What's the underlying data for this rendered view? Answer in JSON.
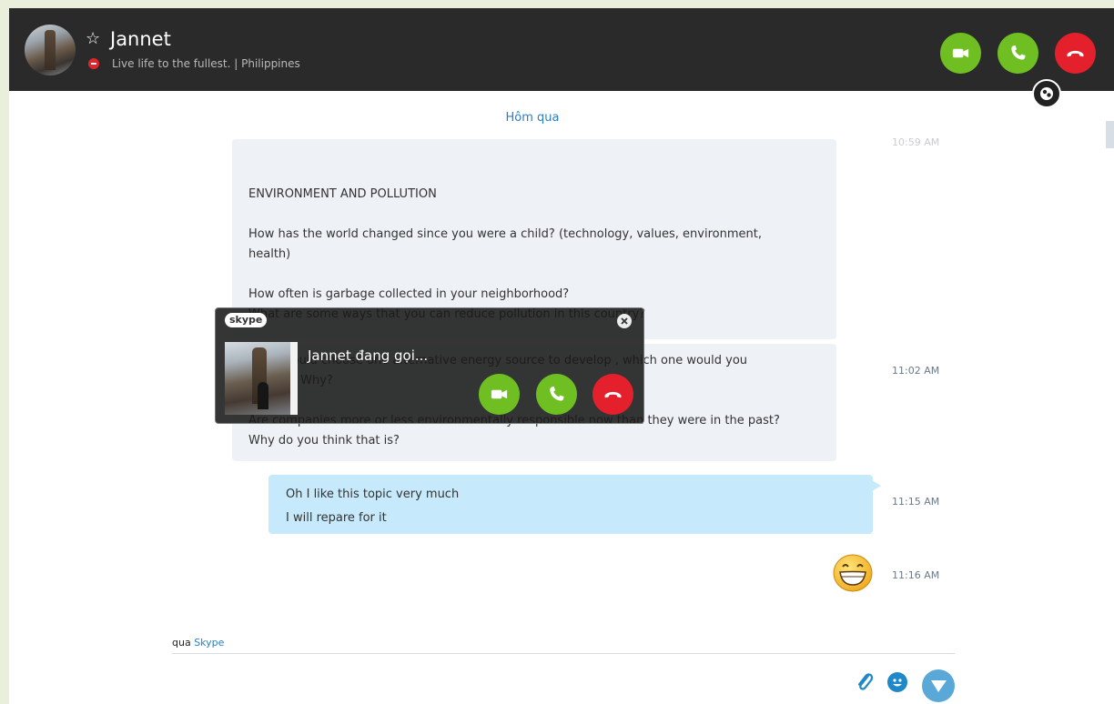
{
  "contact": {
    "name": "Jannet",
    "mood": "Live life to the fullest. | Philippines"
  },
  "icons": {
    "avatar": "contact-avatar",
    "favorite": "star-outline-icon",
    "status": "do-not-disturb-icon",
    "video": "video-camera-icon",
    "call": "phone-icon",
    "end": "hang-up-icon",
    "share": "share-screen-icon",
    "attach": "paperclip-icon",
    "emoji": "smiley-icon",
    "send": "send-icon"
  },
  "colors": {
    "green": "#6fbf23",
    "red": "#e3202b",
    "header": "#2a2a2a",
    "incoming": "#eef1f6",
    "outgoing": "#c6e9fb",
    "link": "#2a7fc4"
  },
  "chat": {
    "date_separator": "Hôm qua",
    "faded_time": "10:59 AM",
    "message1": {
      "lines": [
        "ENVIRONMENT AND POLLUTION",
        "",
        "How has the world changed since you were a child? (technology, values, environment,",
        "health)",
        "",
        "How often is garbage collected in your neighborhood?",
        "What are some ways that you can reduce pollution in this country?"
      ]
    },
    "message2": {
      "lines": [
        "If you could choose one alternative energy source to develop , which one would you",
        "choose? Why?",
        "",
        "Are companies more or less environmentally responsible now than they were in the past?",
        "Why do you think that is?"
      ],
      "time": "11:02 AM"
    },
    "message3": {
      "lines": [
        "Oh I like this topic very much",
        "I will repare for it"
      ],
      "time": "11:15 AM"
    },
    "message4": {
      "emoji": "big-grin-emoji",
      "time": "11:16 AM"
    }
  },
  "compose": {
    "via_prefix": "qua",
    "via_link": "Skype"
  },
  "toast": {
    "brand": "skype",
    "caller_text": "Jannet đang gọi..."
  }
}
